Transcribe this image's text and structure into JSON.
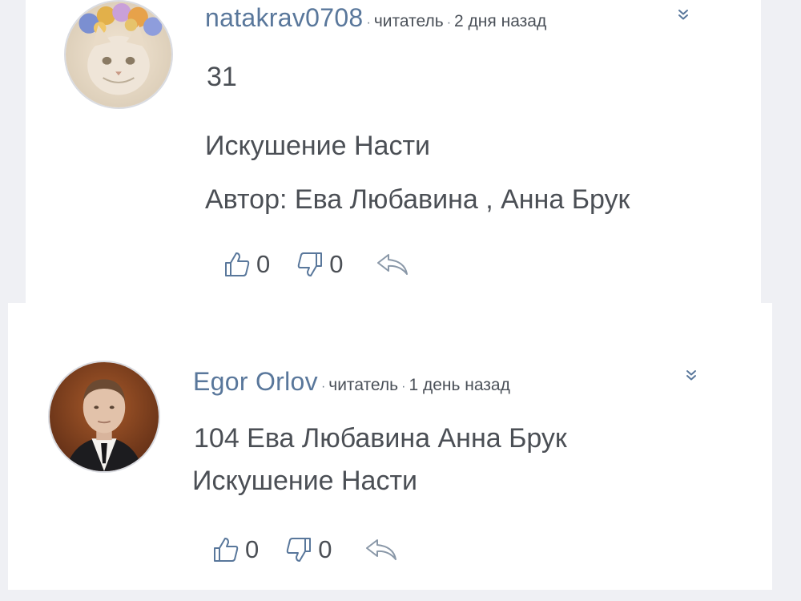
{
  "colors": {
    "accent": "#59779b",
    "text": "#4b4f55",
    "background": "#eff0f4"
  },
  "comments": [
    {
      "avatar": "cat-avatar",
      "username": "natakrav0708",
      "role": "читатель",
      "time": "2 дня назад",
      "lines": [
        "31",
        "Искушение Насти",
        "Автор: Ева Любавина , Анна Брук"
      ],
      "likes": "0",
      "dislikes": "0"
    },
    {
      "avatar": "man-avatar",
      "username": "Egor Orlov",
      "role": "читатель",
      "time": "1 день назад",
      "lines": [
        "104 Ева Любавина Анна Брук",
        "Искушение Насти"
      ],
      "likes": "0",
      "dislikes": "0"
    }
  ]
}
